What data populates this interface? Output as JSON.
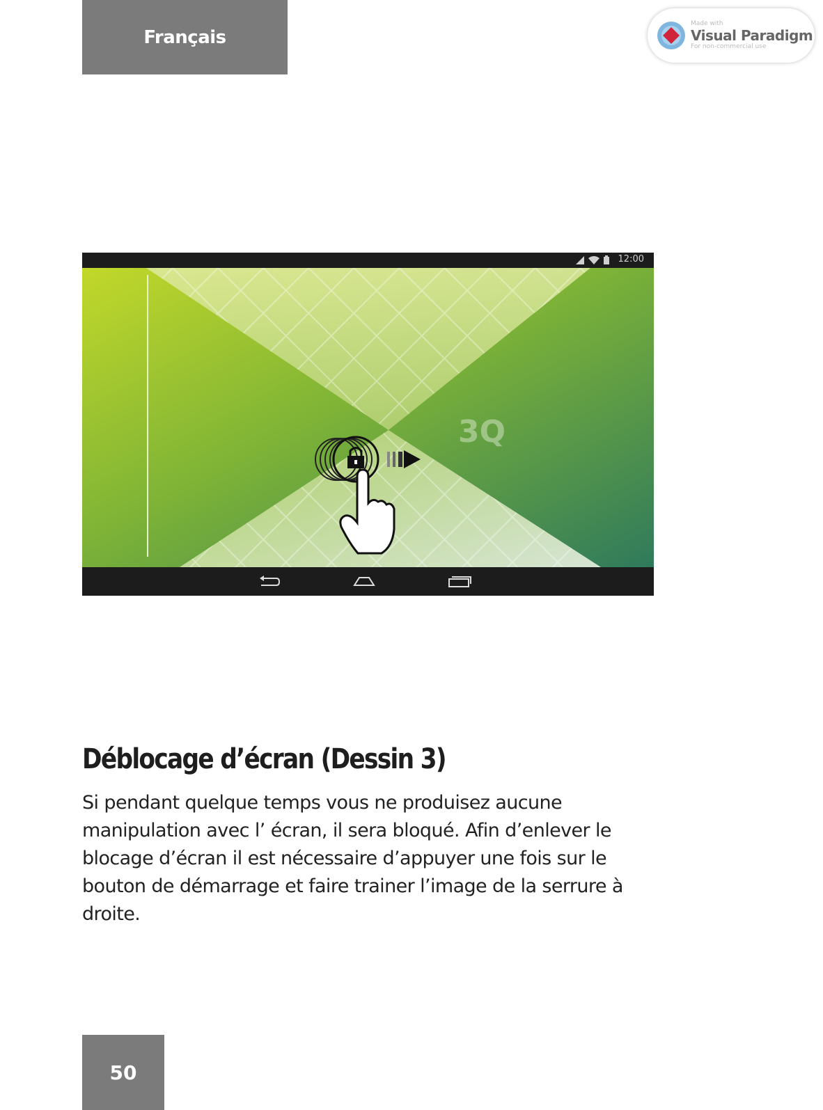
{
  "header": {
    "language_tab": "Français"
  },
  "watermark": {
    "made_with": "Made with",
    "brand": "Visual Paradigm",
    "tagline": "For non-commercial use"
  },
  "device": {
    "status_time": "12:00",
    "icons": [
      "signal-icon",
      "wifi-icon",
      "battery-icon",
      "back-icon",
      "home-icon",
      "recent-apps-icon",
      "lock-icon",
      "hand-pointer-icon",
      "arrow-right-icon"
    ],
    "brand_logo": "3Q"
  },
  "section": {
    "title": "Déblocage d’écran (Dessin 3)",
    "paragraph": "Si pendant quelque temps vous ne produisez aucune manipulation avec l’ écran, il sera bloqué. Afin d’enlever le blocage d’écran il est nécessaire d’appuyer une fois sur le bouton de démarrage et faire trainer l’image de la serrure à droite."
  },
  "footer": {
    "page_number": "50"
  }
}
